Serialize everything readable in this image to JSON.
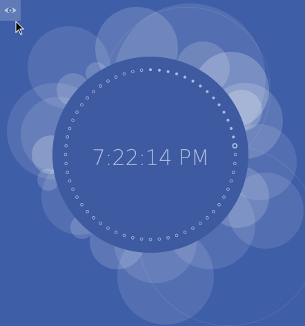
{
  "clock": {
    "time": "7:22:14 PM",
    "seconds": 14
  },
  "toolbar": {
    "eye_icon": "eye-icon"
  },
  "colors": {
    "background": "#3f5ea8",
    "clock_face": "#3e5aa0",
    "text": "#aebbe0"
  }
}
